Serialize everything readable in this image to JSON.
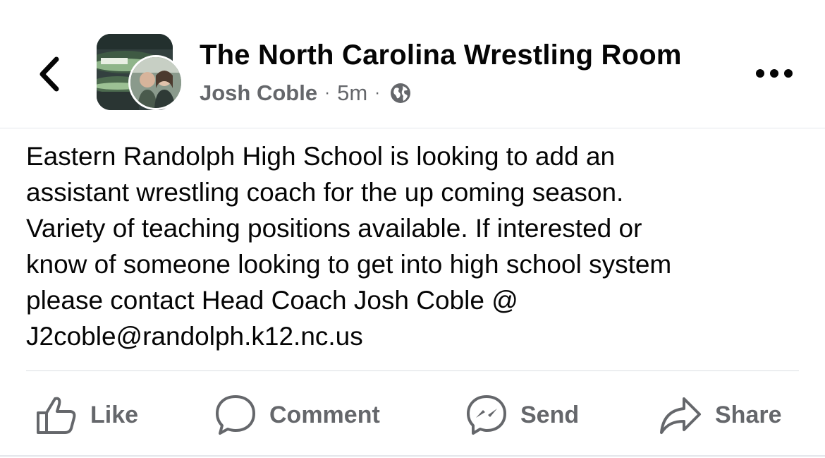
{
  "header": {
    "back_icon": "chevron-left-icon",
    "group_avatar_icon": "group-photo",
    "user_avatar_icon": "user-photo",
    "group_name": "The North Carolina Wrestling Room",
    "author": "Josh Coble",
    "separator": "·",
    "time": "5m",
    "privacy_icon": "globe-icon",
    "more_icon": "more-horizontal-icon"
  },
  "post": {
    "lines": [
      "Eastern Randolph High School is looking to add an",
      "assistant wrestling coach for the up coming season.",
      "Variety of teaching positions available. If interested or",
      "know of someone looking to get into high school system",
      "please contact Head Coach Josh Coble @",
      "J2coble@randolph.k12.nc.us"
    ]
  },
  "actions": {
    "like": {
      "label": "Like",
      "icon": "thumbs-up-icon"
    },
    "comment": {
      "label": "Comment",
      "icon": "comment-bubble-icon"
    },
    "send": {
      "label": "Send",
      "icon": "messenger-icon"
    },
    "share": {
      "label": "Share",
      "icon": "share-arrow-icon"
    }
  },
  "colors": {
    "text_primary": "#050505",
    "text_secondary": "#65676b",
    "divider": "#e4e6eb"
  }
}
